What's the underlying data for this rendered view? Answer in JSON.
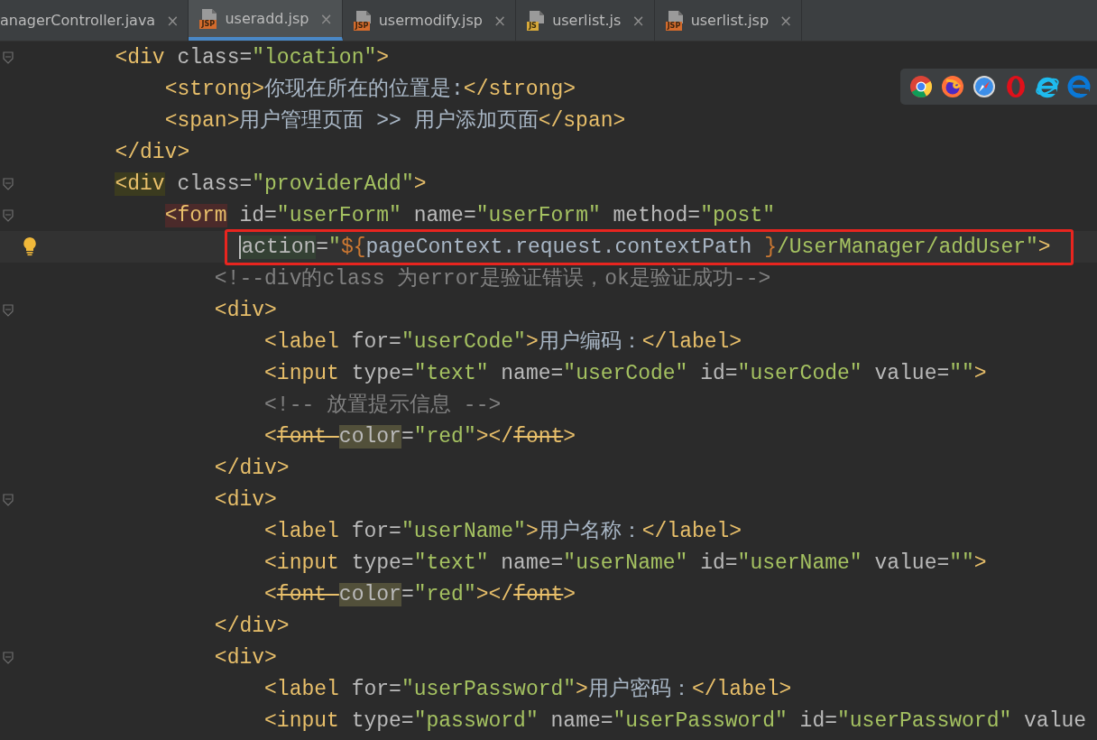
{
  "tabs": [
    {
      "label": "anagerController.java",
      "close": "×",
      "selected": false
    },
    {
      "label": "useradd.jsp",
      "badge": "JSP",
      "kind": "jsp",
      "close": "×",
      "selected": true
    },
    {
      "label": "usermodify.jsp",
      "badge": "JSP",
      "kind": "jsp",
      "close": "×",
      "selected": false
    },
    {
      "label": "userlist.js",
      "badge": "JS",
      "kind": "js",
      "close": "×",
      "selected": false
    },
    {
      "label": "userlist.jsp",
      "badge": "JSP",
      "kind": "jsp",
      "close": "×",
      "selected": false
    }
  ],
  "browsers": [
    {
      "kind": "chrome"
    },
    {
      "kind": "firefox"
    },
    {
      "kind": "safari"
    },
    {
      "kind": "opera"
    },
    {
      "kind": "ie"
    },
    {
      "kind": "edge"
    }
  ],
  "code": [
    {
      "tokens": [
        {
          "kind": "tag",
          "text": "<div"
        },
        {
          "kind": "attr",
          "text": " class="
        },
        {
          "kind": "string",
          "text": "\"location\""
        },
        {
          "kind": "tag",
          "text": ">"
        }
      ],
      "children": [
        {
          "tokens": [
            {
              "kind": "tag",
              "text": "<strong>"
            },
            {
              "kind": "text",
              "text": "你现在所在的位置是:"
            },
            {
              "kind": "tag",
              "text": "</strong>"
            }
          ]
        },
        {
          "tokens": [
            {
              "kind": "tag",
              "text": "<span>"
            },
            {
              "kind": "text",
              "text": "用户管理页面 >> 用户添加页面"
            },
            {
              "kind": "tag",
              "text": "</span>"
            }
          ]
        }
      ]
    },
    {
      "tokens": [
        {
          "kind": "tag",
          "text": "</div>"
        }
      ]
    },
    {
      "tokens": [
        {
          "kind": "tag",
          "text": "<div",
          "paired": true
        },
        {
          "kind": "attr",
          "text": " class="
        },
        {
          "kind": "string",
          "text": "\"providerAdd\""
        },
        {
          "kind": "tag",
          "text": ">"
        }
      ],
      "children": [
        {
          "tokens": [
            {
              "kind": "tag",
              "text": "<form",
              "error": true
            },
            {
              "kind": "attr",
              "text": " id="
            },
            {
              "kind": "string",
              "text": "\"userForm\""
            },
            {
              "kind": "attr",
              "text": " name="
            },
            {
              "kind": "string",
              "text": "\"userForm\""
            },
            {
              "kind": "attr",
              "text": " method="
            },
            {
              "kind": "string",
              "text": "\"post\""
            }
          ],
          "children": [
            {
              "kind": "continuation",
              "current": true,
              "intention": true,
              "boxed": true,
              "tokens": [
                {
                  "kind": "attr",
                  "text": "action",
                  "at_caret": true
                },
                {
                  "kind": "attr",
                  "text": "="
                },
                {
                  "kind": "string",
                  "text": "\""
                },
                {
                  "kind": "expr",
                  "text": "${"
                },
                {
                  "kind": "text",
                  "text": "pageContext.request.contextPath "
                },
                {
                  "kind": "expr",
                  "text": "}"
                },
                {
                  "kind": "string",
                  "text": "/UserManager/addUser\""
                },
                {
                  "kind": "tag",
                  "text": ">"
                }
              ]
            },
            {
              "tokens": [
                {
                  "kind": "comment",
                  "text": "<!--div的class 为error是验证错误，ok是验证成功-->"
                }
              ]
            },
            {
              "tokens": [
                {
                  "kind": "tag",
                  "text": "<div>"
                }
              ],
              "children": [
                {
                  "tokens": [
                    {
                      "kind": "tag",
                      "text": "<label"
                    },
                    {
                      "kind": "attr",
                      "text": " for="
                    },
                    {
                      "kind": "string",
                      "text": "\"userCode\""
                    },
                    {
                      "kind": "tag",
                      "text": ">"
                    },
                    {
                      "kind": "text",
                      "text": "用户编码："
                    },
                    {
                      "kind": "tag",
                      "text": "</label>"
                    }
                  ]
                },
                {
                  "tokens": [
                    {
                      "kind": "tag",
                      "text": "<input"
                    },
                    {
                      "kind": "attr",
                      "text": " type="
                    },
                    {
                      "kind": "string",
                      "text": "\"text\""
                    },
                    {
                      "kind": "attr",
                      "text": " name="
                    },
                    {
                      "kind": "string",
                      "text": "\"userCode\""
                    },
                    {
                      "kind": "attr",
                      "text": " id="
                    },
                    {
                      "kind": "string",
                      "text": "\"userCode\""
                    },
                    {
                      "kind": "attr",
                      "text": " value="
                    },
                    {
                      "kind": "string",
                      "text": "\"\""
                    },
                    {
                      "kind": "tag",
                      "text": ">"
                    }
                  ]
                },
                {
                  "tokens": [
                    {
                      "kind": "comment",
                      "text": "<!-- 放置提示信息 -->"
                    }
                  ]
                },
                {
                  "tokens": [
                    {
                      "kind": "tag",
                      "text": "<"
                    },
                    {
                      "kind": "deprecated",
                      "text": "font "
                    },
                    {
                      "kind": "attr",
                      "text": "color",
                      "usage": true
                    },
                    {
                      "kind": "attr",
                      "text": "="
                    },
                    {
                      "kind": "string",
                      "text": "\"red\""
                    },
                    {
                      "kind": "tag",
                      "text": "></"
                    },
                    {
                      "kind": "deprecated",
                      "text": "font"
                    },
                    {
                      "kind": "tag",
                      "text": ">"
                    }
                  ]
                }
              ]
            },
            {
              "tokens": [
                {
                  "kind": "tag",
                  "text": "</div>"
                }
              ]
            },
            {
              "tokens": [
                {
                  "kind": "tag",
                  "text": "<div>"
                }
              ],
              "children": [
                {
                  "tokens": [
                    {
                      "kind": "tag",
                      "text": "<label"
                    },
                    {
                      "kind": "attr",
                      "text": " for="
                    },
                    {
                      "kind": "string",
                      "text": "\"userName\""
                    },
                    {
                      "kind": "tag",
                      "text": ">"
                    },
                    {
                      "kind": "text",
                      "text": "用户名称："
                    },
                    {
                      "kind": "tag",
                      "text": "</label>"
                    }
                  ]
                },
                {
                  "tokens": [
                    {
                      "kind": "tag",
                      "text": "<input"
                    },
                    {
                      "kind": "attr",
                      "text": " type="
                    },
                    {
                      "kind": "string",
                      "text": "\"text\""
                    },
                    {
                      "kind": "attr",
                      "text": " name="
                    },
                    {
                      "kind": "string",
                      "text": "\"userName\""
                    },
                    {
                      "kind": "attr",
                      "text": " id="
                    },
                    {
                      "kind": "string",
                      "text": "\"userName\""
                    },
                    {
                      "kind": "attr",
                      "text": " value="
                    },
                    {
                      "kind": "string",
                      "text": "\"\""
                    },
                    {
                      "kind": "tag",
                      "text": ">"
                    }
                  ]
                },
                {
                  "tokens": [
                    {
                      "kind": "tag",
                      "text": "<"
                    },
                    {
                      "kind": "deprecated",
                      "text": "font "
                    },
                    {
                      "kind": "attr",
                      "text": "color",
                      "usage": true
                    },
                    {
                      "kind": "attr",
                      "text": "="
                    },
                    {
                      "kind": "string",
                      "text": "\"red\""
                    },
                    {
                      "kind": "tag",
                      "text": "></"
                    },
                    {
                      "kind": "deprecated",
                      "text": "font"
                    },
                    {
                      "kind": "tag",
                      "text": ">"
                    }
                  ]
                }
              ]
            },
            {
              "tokens": [
                {
                  "kind": "tag",
                  "text": "</div>"
                }
              ]
            },
            {
              "tokens": [
                {
                  "kind": "tag",
                  "text": "<div>"
                }
              ],
              "children": [
                {
                  "tokens": [
                    {
                      "kind": "tag",
                      "text": "<label"
                    },
                    {
                      "kind": "attr",
                      "text": " for="
                    },
                    {
                      "kind": "string",
                      "text": "\"userPassword\""
                    },
                    {
                      "kind": "tag",
                      "text": ">"
                    },
                    {
                      "kind": "text",
                      "text": "用户密码："
                    },
                    {
                      "kind": "tag",
                      "text": "</label>"
                    }
                  ]
                },
                {
                  "tokens": [
                    {
                      "kind": "tag",
                      "text": "<input"
                    },
                    {
                      "kind": "attr",
                      "text": " type="
                    },
                    {
                      "kind": "string",
                      "text": "\"password\""
                    },
                    {
                      "kind": "attr",
                      "text": " name="
                    },
                    {
                      "kind": "string",
                      "text": "\"userPassword\""
                    },
                    {
                      "kind": "attr",
                      "text": " id="
                    },
                    {
                      "kind": "string",
                      "text": "\"userPassword\""
                    },
                    {
                      "kind": "attr",
                      "text": " value"
                    }
                  ]
                }
              ]
            }
          ]
        }
      ]
    }
  ]
}
